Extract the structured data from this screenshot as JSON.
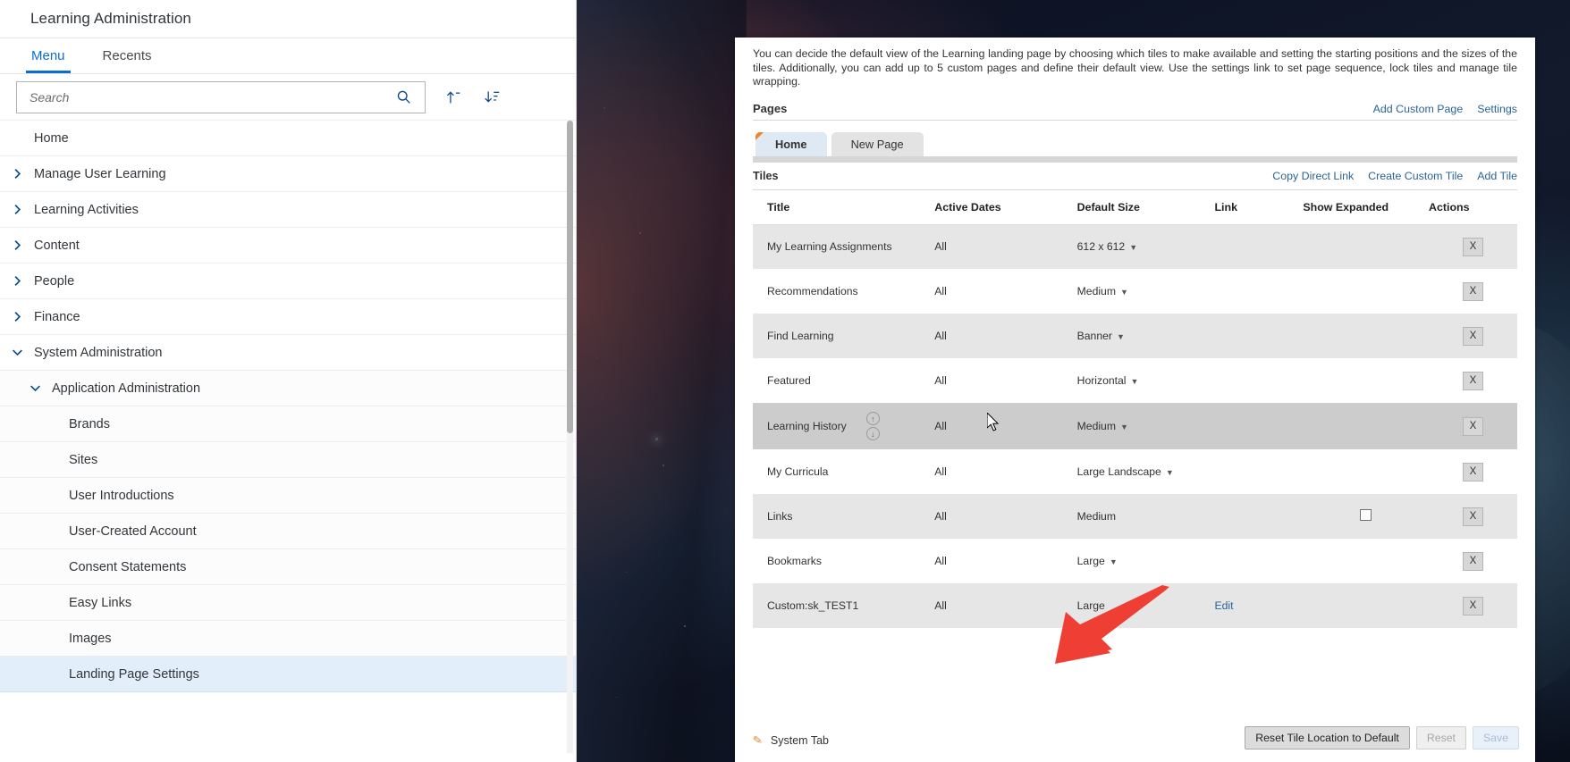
{
  "app": {
    "title": "Learning Administration"
  },
  "nav": {
    "tabs": [
      {
        "label": "Menu",
        "active": true
      },
      {
        "label": "Recents",
        "active": false
      }
    ],
    "search": {
      "placeholder": "Search",
      "value": ""
    },
    "icons": {
      "search": "search-icon",
      "collapse_all": "collapse-all-icon",
      "sort": "sort-descending-icon"
    },
    "items": [
      {
        "label": "Home",
        "level": 0,
        "chevron": "none",
        "selected": false
      },
      {
        "label": "Manage User Learning",
        "level": 0,
        "chevron": "right",
        "selected": false
      },
      {
        "label": "Learning Activities",
        "level": 0,
        "chevron": "right",
        "selected": false
      },
      {
        "label": "Content",
        "level": 0,
        "chevron": "right",
        "selected": false
      },
      {
        "label": "People",
        "level": 0,
        "chevron": "right",
        "selected": false
      },
      {
        "label": "Finance",
        "level": 0,
        "chevron": "right",
        "selected": false
      },
      {
        "label": "System Administration",
        "level": 0,
        "chevron": "down",
        "selected": false
      },
      {
        "label": "Application Administration",
        "level": 1,
        "chevron": "down",
        "selected": false
      },
      {
        "label": "Brands",
        "level": 2,
        "chevron": "none",
        "selected": false
      },
      {
        "label": "Sites",
        "level": 2,
        "chevron": "none",
        "selected": false
      },
      {
        "label": "User Introductions",
        "level": 2,
        "chevron": "none",
        "selected": false
      },
      {
        "label": "User-Created Account",
        "level": 2,
        "chevron": "none",
        "selected": false
      },
      {
        "label": "Consent Statements",
        "level": 2,
        "chevron": "none",
        "selected": false
      },
      {
        "label": "Easy Links",
        "level": 2,
        "chevron": "none",
        "selected": false
      },
      {
        "label": "Images",
        "level": 2,
        "chevron": "none",
        "selected": false
      },
      {
        "label": "Landing Page Settings",
        "level": 2,
        "chevron": "none",
        "selected": true
      }
    ]
  },
  "main": {
    "intro": "You can decide the default view of the Learning landing page by choosing which tiles to make available and setting the starting positions and the sizes of the tiles. Additionally, you can add up to 5 custom pages and define their default view. Use the settings link to set page sequence, lock tiles and manage tile wrapping.",
    "pages_section": {
      "label": "Pages",
      "links": [
        "Add Custom Page",
        "Settings"
      ]
    },
    "page_tabs": [
      {
        "label": "Home",
        "active": true
      },
      {
        "label": "New Page",
        "active": false
      }
    ],
    "tiles_section": {
      "label": "Tiles",
      "links": [
        "Copy Direct Link",
        "Create Custom Tile",
        "Add Tile"
      ]
    },
    "table": {
      "columns": [
        "Title",
        "Active Dates",
        "Default Size",
        "Link",
        "Show Expanded",
        "Actions"
      ],
      "rows": [
        {
          "title": "My Learning Assignments",
          "dates": "All",
          "size": "612 x 612",
          "size_dropdown": true,
          "link": "",
          "expanded": "",
          "action": "X",
          "reorder": false,
          "shade": "alt"
        },
        {
          "title": "Recommendations",
          "dates": "All",
          "size": "Medium",
          "size_dropdown": true,
          "link": "",
          "expanded": "",
          "action": "X",
          "reorder": false,
          "shade": "plain"
        },
        {
          "title": "Find Learning",
          "dates": "All",
          "size": "Banner",
          "size_dropdown": true,
          "link": "",
          "expanded": "",
          "action": "X",
          "reorder": false,
          "shade": "alt"
        },
        {
          "title": "Featured",
          "dates": "All",
          "size": "Horizontal",
          "size_dropdown": true,
          "link": "",
          "expanded": "",
          "action": "X",
          "reorder": false,
          "shade": "plain"
        },
        {
          "title": "Learning History",
          "dates": "All",
          "size": "Medium",
          "size_dropdown": true,
          "link": "",
          "expanded": "",
          "action": "X",
          "reorder": true,
          "shade": "hover"
        },
        {
          "title": "My Curricula",
          "dates": "All",
          "size": "Large Landscape",
          "size_dropdown": true,
          "link": "",
          "expanded": "",
          "action": "X",
          "reorder": false,
          "shade": "plain"
        },
        {
          "title": "Links",
          "dates": "All",
          "size": "Medium",
          "size_dropdown": false,
          "link": "",
          "expanded": "checkbox",
          "action": "X",
          "reorder": false,
          "shade": "alt"
        },
        {
          "title": "Bookmarks",
          "dates": "All",
          "size": "Large",
          "size_dropdown": true,
          "link": "",
          "expanded": "",
          "action": "X",
          "reorder": false,
          "shade": "plain"
        },
        {
          "title": "Custom:sk_TEST1",
          "dates": "All",
          "size": "Large",
          "size_dropdown": false,
          "link": "Edit",
          "expanded": "",
          "action": "X",
          "reorder": false,
          "shade": "alt"
        }
      ]
    },
    "system_tab": {
      "label": "System Tab",
      "icon": "pencil-icon"
    },
    "footer_buttons": [
      {
        "label": "Reset Tile Location to Default",
        "disabled": false
      },
      {
        "label": "Reset",
        "disabled": true
      },
      {
        "label": "Save",
        "disabled": true
      }
    ]
  },
  "annotation": {
    "type": "red-arrow",
    "points_to": "Reset Tile Location to Default"
  },
  "colors": {
    "accent_blue": "#0a6ed1",
    "link_blue": "#2a6496",
    "tab_orange": "#f0842a",
    "selected_row": "#e3eefb",
    "annotation_red": "#ef3e33"
  }
}
